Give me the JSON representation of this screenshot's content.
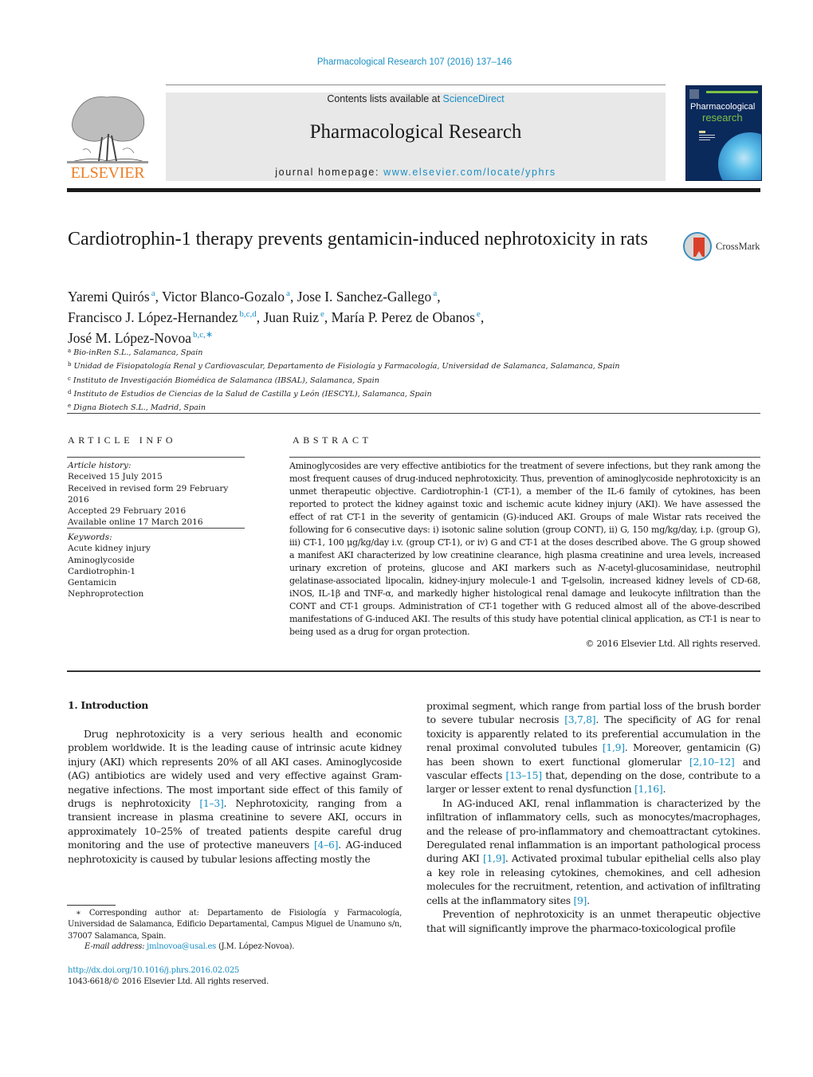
{
  "header": {
    "citation": "Pharmacological Research 107 (2016) 137–146",
    "contents_prefix": "Contents lists available at ",
    "contents_link": "ScienceDirect",
    "journal_title": "Pharmacological Research",
    "homepage_prefix": "journal homepage: ",
    "homepage_link": "www.elsevier.com/locate/yphrs",
    "publisher_logo": "ELSEVIER",
    "cover_title_line1": "Pharmacological",
    "cover_title_line2": "research",
    "colors": {
      "link": "#1a8fc4",
      "elsevier_orange": "#ee7d24",
      "cover_navy": "#0b2a5c",
      "cover_green": "#7cc143"
    }
  },
  "article": {
    "title": "Cardiotrophin-1 therapy prevents gentamicin-induced nephrotoxicity in rats",
    "crossmark_label": "CrossMark",
    "authors": [
      {
        "name": "Yaremi Quirós",
        "affil": "a",
        "sep": ", "
      },
      {
        "name": "Victor Blanco-Gozalo",
        "affil": "a",
        "sep": ", "
      },
      {
        "name": "Jose I. Sanchez-Gallego",
        "affil": "a",
        "sep": ","
      },
      {
        "name": "Francisco J. López-Hernandez",
        "affil": "b,c,d",
        "sep": ", "
      },
      {
        "name": "Juan Ruiz",
        "affil": "e",
        "sep": ", "
      },
      {
        "name": "María P. Perez de Obanos",
        "affil": "e",
        "sep": ","
      },
      {
        "name": "José M. López-Novoa",
        "affil": "b,c,∗",
        "sep": ""
      }
    ],
    "affiliations": [
      {
        "key": "a",
        "text": "Bio-inRen S.L., Salamanca, Spain"
      },
      {
        "key": "b",
        "text": "Unidad de Fisiopatología Renal y Cardiovascular, Departamento de Fisiología y Farmacología, Universidad de Salamanca, Salamanca, Spain"
      },
      {
        "key": "c",
        "text": "Instituto de Investigación Biomédica de Salamanca (IBSAL), Salamanca, Spain"
      },
      {
        "key": "d",
        "text": "Instituto de Estudios de Ciencias de la Salud de Castilla y León (IESCYL), Salamanca, Spain"
      },
      {
        "key": "e",
        "text": "Digna Biotech S.L., Madrid, Spain"
      }
    ]
  },
  "article_info": {
    "heading": "ARTICLE INFO",
    "history_label": "Article history:",
    "history": [
      "Received 15 July 2015",
      "Received in revised form 29 February 2016",
      "Accepted 29 February 2016",
      "Available online 17 March 2016"
    ],
    "keywords_label": "Keywords:",
    "keywords": [
      "Acute kidney injury",
      "Aminoglycoside",
      "Cardiotrophin-1",
      "Gentamicin",
      "Nephroprotection"
    ]
  },
  "abstract": {
    "heading": "ABSTRACT",
    "text_part1": "Aminoglycosides are very effective antibiotics for the treatment of severe infections, but they rank among the most frequent causes of drug-induced nephrotoxicity. Thus, prevention of aminoglycoside nephrotoxicity is an unmet therapeutic objective. Cardiotrophin-1 (CT-1), a member of the IL-6 family of cytokines, has been reported to protect the kidney against toxic and ischemic acute kidney injury (AKI). We have assessed the effect of rat CT-1 in the severity of gentamicin (G)-induced AKI. Groups of male Wistar rats received the following for 6 consecutive days: i) isotonic saline solution (group CONT), ii) G, 150 mg/kg/day, i.p. (group G), iii) CT-1, 100 μg/kg/day i.v. (group CT-1), or iv) G and CT-1 at the doses described above. The G group showed a manifest AKI characterized by low creatinine clearance, high plasma creatinine and urea levels, increased urinary excretion of proteins, glucose and AKI markers such as ",
    "text_italic": "N",
    "text_part2": "-acetyl-glucosaminidase, neutrophil gelatinase-associated lipocalin, kidney-injury molecule-1 and T-gelsolin, increased kidney levels of CD-68, iNOS, IL-1β and TNF-α, and markedly higher histological renal damage and leukocyte infiltration than the CONT and CT-1 groups. Administration of CT-1 together with G reduced almost all of the above-described manifestations of G-induced AKI. The results of this study have potential clinical application, as CT-1 is near to being used as a drug for organ protection.",
    "copyright": "© 2016 Elsevier Ltd. All rights reserved."
  },
  "body": {
    "section_heading": "1.  Introduction",
    "left_p1": [
      {
        "t": "Drug nephrotoxicity is a very serious health and economic problem worldwide. It is the leading cause of intrinsic acute kidney injury (AKI) which represents 20% of all AKI cases. Aminoglycoside (AG) antibiotics are widely used and very effective against Gram-negative infections. The most important side effect of this family of drugs is nephrotoxicity "
      },
      {
        "ref": "[1–3]"
      },
      {
        "t": ". Nephrotoxicity, ranging from a transient increase in plasma creatinine to severe AKI, occurs in approximately 10–25% of treated patients despite careful drug monitoring and the use of protective maneuvers "
      },
      {
        "ref": "[4–6]"
      },
      {
        "t": ". AG-induced nephrotoxicity is caused by tubular lesions affecting mostly the"
      }
    ],
    "right_p1": [
      {
        "t": "proximal segment, which range from partial loss of the brush border to severe tubular necrosis "
      },
      {
        "ref": "[3,7,8]"
      },
      {
        "t": ". The specificity of AG for renal toxicity is apparently related to its preferential accumulation in the renal proximal convoluted tubules "
      },
      {
        "ref": "[1,9]"
      },
      {
        "t": ". Moreover, gentamicin (G) has been shown to exert functional glomerular "
      },
      {
        "ref": "[2,10–12]"
      },
      {
        "t": " and vascular effects "
      },
      {
        "ref": "[13–15]"
      },
      {
        "t": " that, depending on the dose, contribute to a larger or lesser extent to renal dysfunction "
      },
      {
        "ref": "[1,16]"
      },
      {
        "t": "."
      }
    ],
    "right_p2": [
      {
        "t": "In AG-induced AKI, renal inflammation is characterized by the infiltration of inflammatory cells, such as monocytes/macrophages, and the release of pro-inflammatory and chemoattractant cytokines. Deregulated renal inflammation is an important pathological process during AKI "
      },
      {
        "ref": "[1,9]"
      },
      {
        "t": ". Activated proximal tubular epithelial cells also play a key role in releasing cytokines, chemokines, and cell adhesion molecules for the recruitment, retention, and activation of infiltrating cells at the inflammatory sites "
      },
      {
        "ref": "[9]"
      },
      {
        "t": "."
      }
    ],
    "right_p3": [
      {
        "t": "Prevention of nephrotoxicity is an unmet therapeutic objective that will significantly improve the pharmaco-toxicological profile"
      }
    ]
  },
  "footnotes": {
    "corresponding": "∗ Corresponding author at: Departamento de Fisiología y Farmacología, Universidad de Salamanca, Edificio Departamental, Campus Miguel de Unamuno s/n, 37007 Salamanca, Spain.",
    "email_label": "E-mail address: ",
    "email": "jmlnovoa@usal.es",
    "email_suffix": " (J.M. López-Novoa).",
    "doi": "http://dx.doi.org/10.1016/j.phrs.2016.02.025",
    "issn": "1043-6618/© 2016 Elsevier Ltd. All rights reserved."
  }
}
